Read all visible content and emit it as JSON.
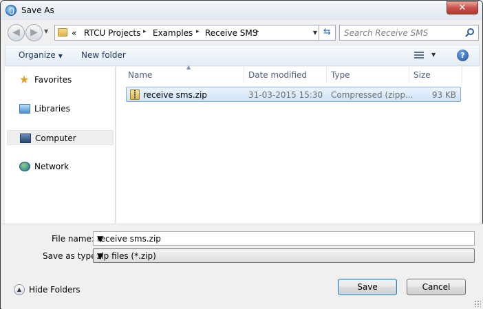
{
  "window": {
    "title": "Save As",
    "close_label": "✕"
  },
  "address_bar": {
    "overflow": "«",
    "path": [
      "RTCU Projects",
      "Examples",
      "Receive SMS"
    ],
    "separator": "▸"
  },
  "search": {
    "placeholder": "Search Receive SMS"
  },
  "toolbar": {
    "organize_label": "Organize",
    "new_folder_label": "New folder",
    "help_label": "?"
  },
  "nav_pane": {
    "items": [
      {
        "label": "Favorites",
        "icon": "star-icon"
      },
      {
        "label": "Libraries",
        "icon": "libraries-icon"
      },
      {
        "label": "Computer",
        "icon": "computer-icon",
        "selected": true
      },
      {
        "label": "Network",
        "icon": "network-icon"
      }
    ]
  },
  "file_list": {
    "columns": [
      "Name",
      "Date modified",
      "Type",
      "Size"
    ],
    "rows": [
      {
        "name": "receive sms.zip",
        "date": "31-03-2015 15:30",
        "type": "Compressed (zipp...",
        "size": "93 KB",
        "selected": true
      }
    ]
  },
  "form": {
    "file_name_label": "File name:",
    "file_name_value": "receive sms.zip",
    "save_type_label": "Save as type:",
    "save_type_value": "zip files (*.zip)"
  },
  "footer": {
    "hide_folders_label": "Hide Folders",
    "save_label": "Save",
    "cancel_label": "Cancel"
  }
}
